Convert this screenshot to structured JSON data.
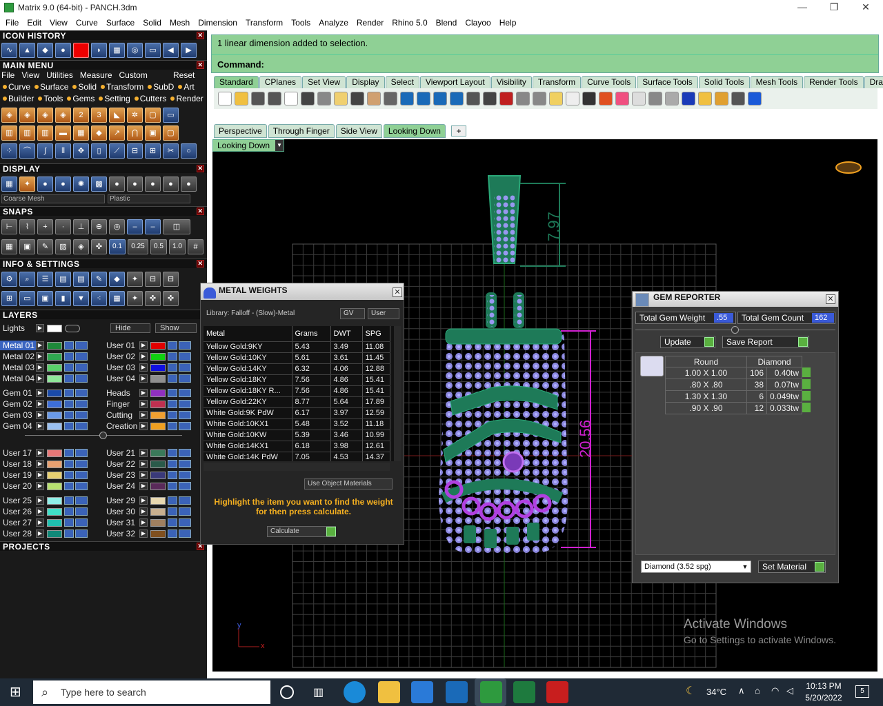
{
  "window": {
    "title": "Matrix 9.0 (64-bit) - PANCH.3dm",
    "minimize": "—",
    "restore": "❐",
    "close": "✕"
  },
  "menu": [
    "File",
    "Edit",
    "View",
    "Curve",
    "Surface",
    "Solid",
    "Mesh",
    "Dimension",
    "Transform",
    "Tools",
    "Analyze",
    "Render",
    "Rhino 5.0",
    "Blend",
    "Clayoo",
    "Help"
  ],
  "left_panel": {
    "icon_history": "ICON HISTORY",
    "main_menu": "MAIN MENU",
    "main_menu_row1": [
      "File",
      "View",
      "Utilities",
      "Measure",
      "Custom"
    ],
    "reset": "Reset",
    "main_menu_row2": [
      "Curve",
      "Surface",
      "Solid",
      "Transform",
      "SubD",
      "Art"
    ],
    "main_menu_row3": [
      "Builder",
      "Tools",
      "Gems",
      "Setting",
      "Cutters",
      "Render"
    ],
    "display": "DISPLAY",
    "display_mesh": "Coarse Mesh",
    "display_material": "Plastic",
    "snaps": "SNAPS",
    "snap_values": [
      "0.1",
      "0.25",
      "0.5",
      "1.0"
    ],
    "info_settings": "INFO & SETTINGS",
    "layers": "LAYERS",
    "lights": "Lights",
    "hide": "Hide",
    "show": "Show",
    "projects": "PROJECTS",
    "layers_left": [
      {
        "name": "Metal 01",
        "color": "#1e8a3a",
        "selected": true
      },
      {
        "name": "Metal 02",
        "color": "#2fa850"
      },
      {
        "name": "Metal 03",
        "color": "#5ad06a"
      },
      {
        "name": "Metal 04",
        "color": "#90e89a"
      },
      {
        "name": "Gem 01",
        "color": "#1a4aa8"
      },
      {
        "name": "Gem 02",
        "color": "#3d6ed8"
      },
      {
        "name": "Gem 03",
        "color": "#6a9ae8"
      },
      {
        "name": "Gem 04",
        "color": "#9ac0f0"
      },
      {
        "name": "User 17",
        "color": "#e87878"
      },
      {
        "name": "User 18",
        "color": "#e8a070"
      },
      {
        "name": "User 19",
        "color": "#e8d070"
      },
      {
        "name": "User 20",
        "color": "#b8e070"
      },
      {
        "name": "User 25",
        "color": "#90f0e8"
      },
      {
        "name": "User 26",
        "color": "#40e0c8"
      },
      {
        "name": "User 27",
        "color": "#20c0b0"
      },
      {
        "name": "User 28",
        "color": "#108878"
      }
    ],
    "layers_right": [
      {
        "name": "User 01",
        "color": "#e00000"
      },
      {
        "name": "User 02",
        "color": "#10d010"
      },
      {
        "name": "User 03",
        "color": "#1010e0"
      },
      {
        "name": "User 04",
        "color": "#909090"
      },
      {
        "name": "Heads",
        "color": "#9030c0"
      },
      {
        "name": "Finger",
        "color": "#c03050"
      },
      {
        "name": "Cutting",
        "color": "#f0a030"
      },
      {
        "name": "Creation",
        "color": "#f0a020"
      },
      {
        "name": "User 21",
        "color": "#3a7a5a"
      },
      {
        "name": "User 22",
        "color": "#2a5a4a"
      },
      {
        "name": "User 23",
        "color": "#3a3a7a"
      },
      {
        "name": "User 24",
        "color": "#5a2a5a"
      },
      {
        "name": "User 29",
        "color": "#e8d8b0"
      },
      {
        "name": "User 30",
        "color": "#c8b090"
      },
      {
        "name": "User 31",
        "color": "#a08060"
      },
      {
        "name": "User 32",
        "color": "#805020"
      }
    ]
  },
  "command": {
    "message": "1 linear dimension added to selection.",
    "prompt": "Command:"
  },
  "toolbar_tabs": [
    "Standard",
    "CPlanes",
    "Set View",
    "Display",
    "Select",
    "Viewport Layout",
    "Visibility",
    "Transform",
    "Curve Tools",
    "Surface Tools",
    "Solid Tools",
    "Mesh Tools",
    "Render Tools",
    "Draftin"
  ],
  "viewport_tabs": [
    "Perspective",
    "Through Finger",
    "Side View",
    "Looking Down"
  ],
  "active_viewport": "Looking Down",
  "dimensions": {
    "top": "7.97",
    "side": "20.56"
  },
  "axis": {
    "y": "y",
    "x": "x"
  },
  "watermark": {
    "line1": "Activate Windows",
    "line2": "Go to Settings to activate Windows."
  },
  "metal_weights": {
    "title": "METAL WEIGHTS",
    "library": "Library: Falloff - (Slow)-Metal",
    "gv": "GV",
    "user": "User",
    "headers": [
      "Metal",
      "Grams",
      "DWT",
      "SPG"
    ],
    "rows": [
      [
        "Yellow Gold:9KY",
        "5.43",
        "3.49",
        "11.08"
      ],
      [
        "Yellow Gold:10KY",
        "5.61",
        "3.61",
        "11.45"
      ],
      [
        "Yellow Gold:14KY",
        "6.32",
        "4.06",
        "12.88"
      ],
      [
        "Yellow Gold:18KY",
        "7.56",
        "4.86",
        "15.41"
      ],
      [
        "Yellow Gold:18KY R...",
        "7.56",
        "4.86",
        "15.41"
      ],
      [
        "Yellow Gold:22KY",
        "8.77",
        "5.64",
        "17.89"
      ],
      [
        "White Gold:9K PdW",
        "6.17",
        "3.97",
        "12.59"
      ],
      [
        "White Gold:10KX1",
        "5.48",
        "3.52",
        "11.18"
      ],
      [
        "White Gold:10KW",
        "5.39",
        "3.46",
        "10.99"
      ],
      [
        "White Gold:14KX1",
        "6.18",
        "3.98",
        "12.61"
      ],
      [
        "White Gold:14K PdW",
        "7.05",
        "4.53",
        "14.37"
      ]
    ],
    "use_object_materials": "Use Object Materials",
    "hint": "Highlight the item you want to find the weight for then press calculate.",
    "calculate": "Calculate"
  },
  "gem_reporter": {
    "title": "GEM REPORTER",
    "total_weight_label": "Total Gem Weight",
    "total_weight": ".55",
    "total_count_label": "Total Gem Count",
    "total_count": "162",
    "update": "Update",
    "save_report": "Save Report",
    "col_shape": "Round",
    "col_material": "Diamond",
    "rows": [
      [
        "1.00 X 1.00",
        "106",
        "0.40tw"
      ],
      [
        ".80 X .80",
        "38",
        "0.07tw"
      ],
      [
        "1.30 X 1.30",
        "6",
        "0.049tw"
      ],
      [
        ".90 X .90",
        "12",
        "0.033tw"
      ]
    ],
    "material_select": "Diamond    (3.52 spg)",
    "set_material": "Set Material"
  },
  "taskbar": {
    "search_placeholder": "Type here to search",
    "temp": "34°C",
    "time": "10:13 PM",
    "date": "5/20/2022",
    "notifications": "5"
  }
}
